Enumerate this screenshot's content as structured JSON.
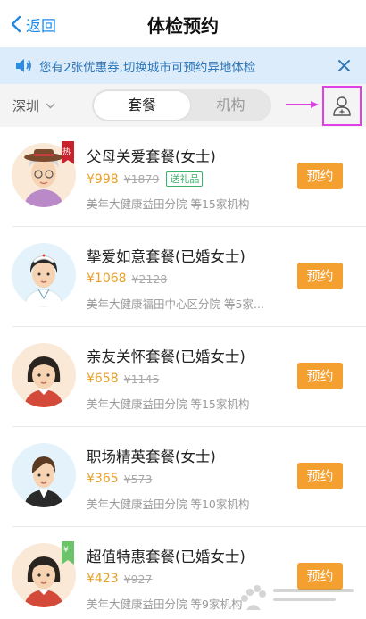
{
  "nav": {
    "back_label": "返回",
    "title": "体检预约"
  },
  "notice": {
    "text": "您有2张优惠券,切换城市可预约异地体检"
  },
  "filter": {
    "city": "深圳",
    "tab_active": "套餐",
    "tab_inactive": "机构"
  },
  "packages": [
    {
      "name": "父母关爱套餐(女士)",
      "price": "¥998",
      "original": "¥1879",
      "gift": "送礼品",
      "org": "美年大健康益田分院  等15家机构",
      "book": "预约",
      "tag": "热"
    },
    {
      "name": "挚爱如意套餐(已婚女士)",
      "price": "¥1068",
      "original": "¥2128",
      "gift": "",
      "org": "美年大健康福田中心区分院  等5家...",
      "book": "预约",
      "tag": ""
    },
    {
      "name": "亲友关怀套餐(已婚女士)",
      "price": "¥658",
      "original": "¥1145",
      "gift": "",
      "org": "美年大健康益田分院  等15家机构",
      "book": "预约",
      "tag": ""
    },
    {
      "name": "职场精英套餐(女士)",
      "price": "¥365",
      "original": "¥573",
      "gift": "",
      "org": "美年大健康益田分院  等10家机构",
      "book": "预约",
      "tag": ""
    },
    {
      "name": "超值特惠套餐(已婚女士)",
      "price": "¥423",
      "original": "¥927",
      "gift": "",
      "org": "美年大健康益田分院  等9家机构",
      "book": "预约",
      "tag": "¥"
    }
  ],
  "colors": {
    "accent_blue": "#1e8ae6",
    "price_orange": "#e8a02b",
    "book_button": "#f4a030",
    "highlight_magenta": "#e040e6",
    "notice_bg": "#dcecfb"
  }
}
